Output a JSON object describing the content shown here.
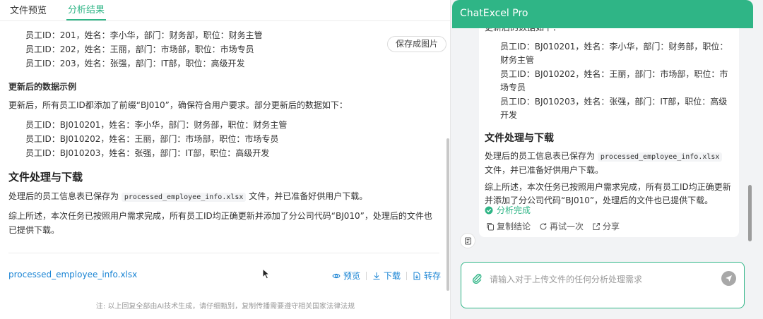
{
  "left": {
    "tabs": [
      {
        "label": "文件预览",
        "active": false
      },
      {
        "label": "分析结果",
        "active": true
      }
    ],
    "save_image_label": "保存成图片",
    "orig_items": [
      "员工ID：201，姓名：李小华，部门：财务部，职位：财务主管",
      "员工ID：202，姓名：王丽，部门：市场部，职位：市场专员",
      "员工ID：203，姓名：张强，部门：IT部，职位：高级开发"
    ],
    "updated_heading": "更新后的数据示例",
    "updated_intro": "更新后，所有员工ID都添加了前缀“BJ010”，确保符合用户要求。部分更新后的数据如下：",
    "updated_items": [
      "员工ID：BJ010201，姓名：李小华，部门：财务部，职位：财务主管",
      "员工ID：BJ010202，姓名：王丽，部门：市场部，职位：市场专员",
      "员工ID：BJ010203，姓名：张强，部门：IT部，职位：高级开发"
    ],
    "section_heading": "文件处理与下载",
    "proc_pre": "处理后的员工信息表已保存为",
    "file_code": "processed_employee_info.xlsx",
    "proc_post": "文件，并已准备好供用户下载。",
    "summary": "综上所述，本次任务已按照用户需求完成，所有员工ID均正确更新并添加了分公司代码“BJ010”，处理后的文件也已提供下载。",
    "file_link": "processed_employee_info.xlsx",
    "actions": {
      "preview": "预览",
      "download": "下载",
      "transfer": "转存"
    },
    "footer_note": "注: 以上回复全部由AI技术生成，请仔细甄别，复制传播需要遵守相关国家法律法规"
  },
  "right": {
    "title": "ChatExcel Pro",
    "clipped_text": "更新后的数据如下：",
    "items": [
      "员工ID：BJ010201，姓名：李小华，部门：财务部，职位：财务主管",
      "员工ID：BJ010202，姓名：王丽，部门：市场部，职位：市场专员",
      "员工ID：BJ010203，姓名：张强，部门：IT部，职位：高级开发"
    ],
    "section_heading": "文件处理与下载",
    "proc_pre": "处理后的员工信息表已保存为",
    "file_code": "processed_employee_info.xlsx",
    "proc_post": "文件，并已准备好供用户下载。",
    "summary": "综上所述，本次任务已按照用户需求完成，所有员工ID均正确更新并添加了分公司代码“BJ010”，处理后的文件也已提供下载。",
    "status": "分析完成",
    "actions": {
      "copy": "复制结论",
      "retry": "再试一次",
      "share": "分享"
    },
    "input_placeholder": "请输入对于上传文件的任何分析处理需求"
  },
  "colors": {
    "accent": "#2fb586",
    "link": "#1a84d4"
  },
  "icons": [
    "eye-icon",
    "download-icon",
    "transfer-icon",
    "check-circle-icon",
    "copy-icon",
    "refresh-icon",
    "share-icon",
    "document-icon",
    "paperclip-icon",
    "send-icon"
  ]
}
